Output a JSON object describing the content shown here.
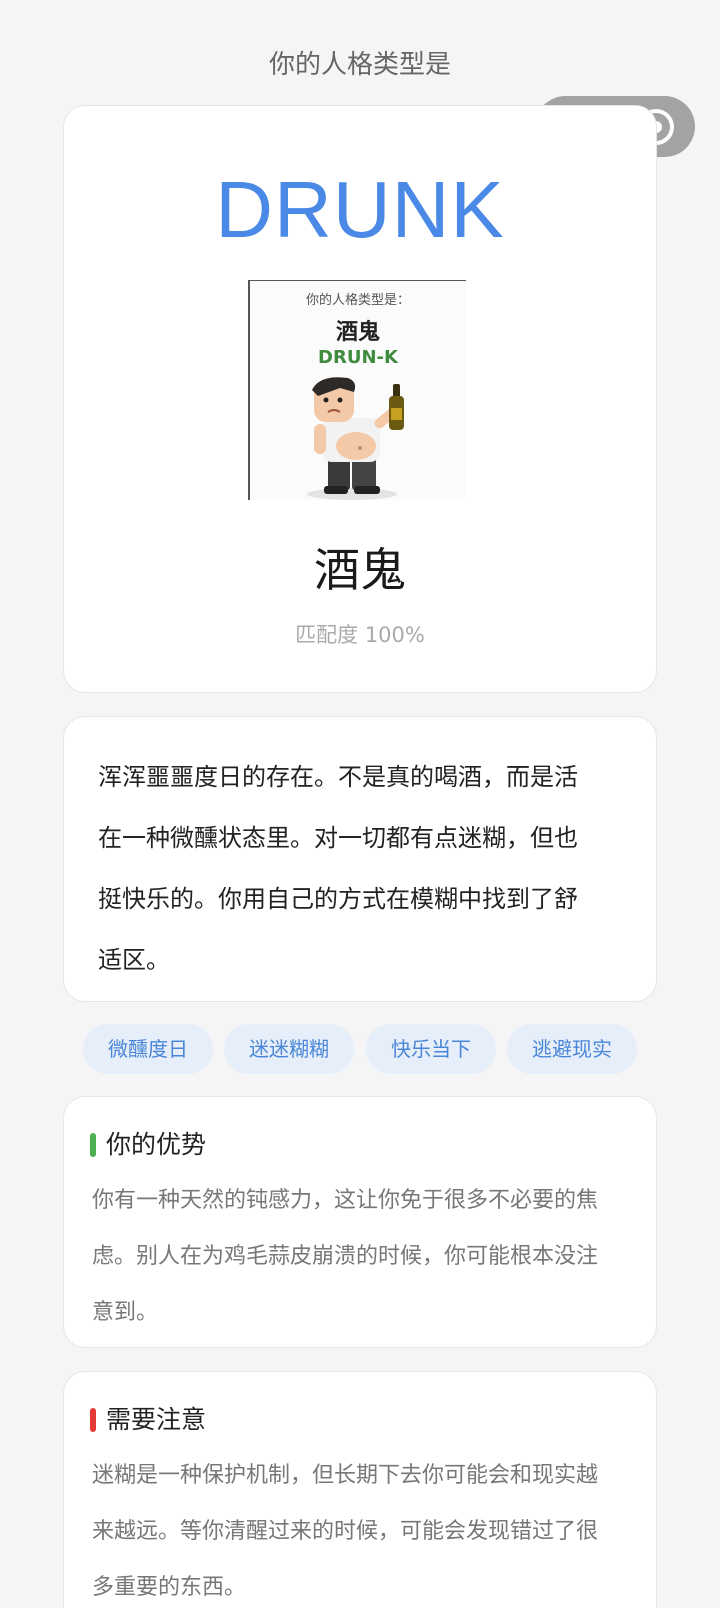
{
  "header": {
    "label": "你的人格类型是"
  },
  "capsule": {
    "more_icon": "more-dots-icon",
    "close_icon": "target-close-icon"
  },
  "result": {
    "type_code": "DRUNK",
    "image": {
      "caption_top": "你的人格类型是：",
      "caption_name": "酒鬼",
      "caption_code": "DRUN-K"
    },
    "name": "酒鬼",
    "match": "匹配度 100%"
  },
  "description": "浑浑噩噩度日的存在。不是真的喝酒，而是活在一种微醺状态里。对一切都有点迷糊，但也挺快乐的。你用自己的方式在模糊中找到了舒适区。",
  "tags": [
    "微醺度日",
    "迷迷糊糊",
    "快乐当下",
    "逃避现实"
  ],
  "advantages": {
    "title": "你的优势",
    "body": "你有一种天然的钝感力，这让你免于很多不必要的焦虑。别人在为鸡毛蒜皮崩溃的时候，你可能根本没注意到。",
    "accent": "#4caf50"
  },
  "caution": {
    "title": "需要注意",
    "body": "迷糊是一种保护机制，但长期下去你可能会和现实越来越远。等你清醒过来的时候，可能会发现错过了很多重要的东西。",
    "accent": "#e53935"
  },
  "colors": {
    "type_code": "#4a8ae6",
    "tag_bg": "#e5eef9",
    "tag_text": "#4a86d8"
  }
}
